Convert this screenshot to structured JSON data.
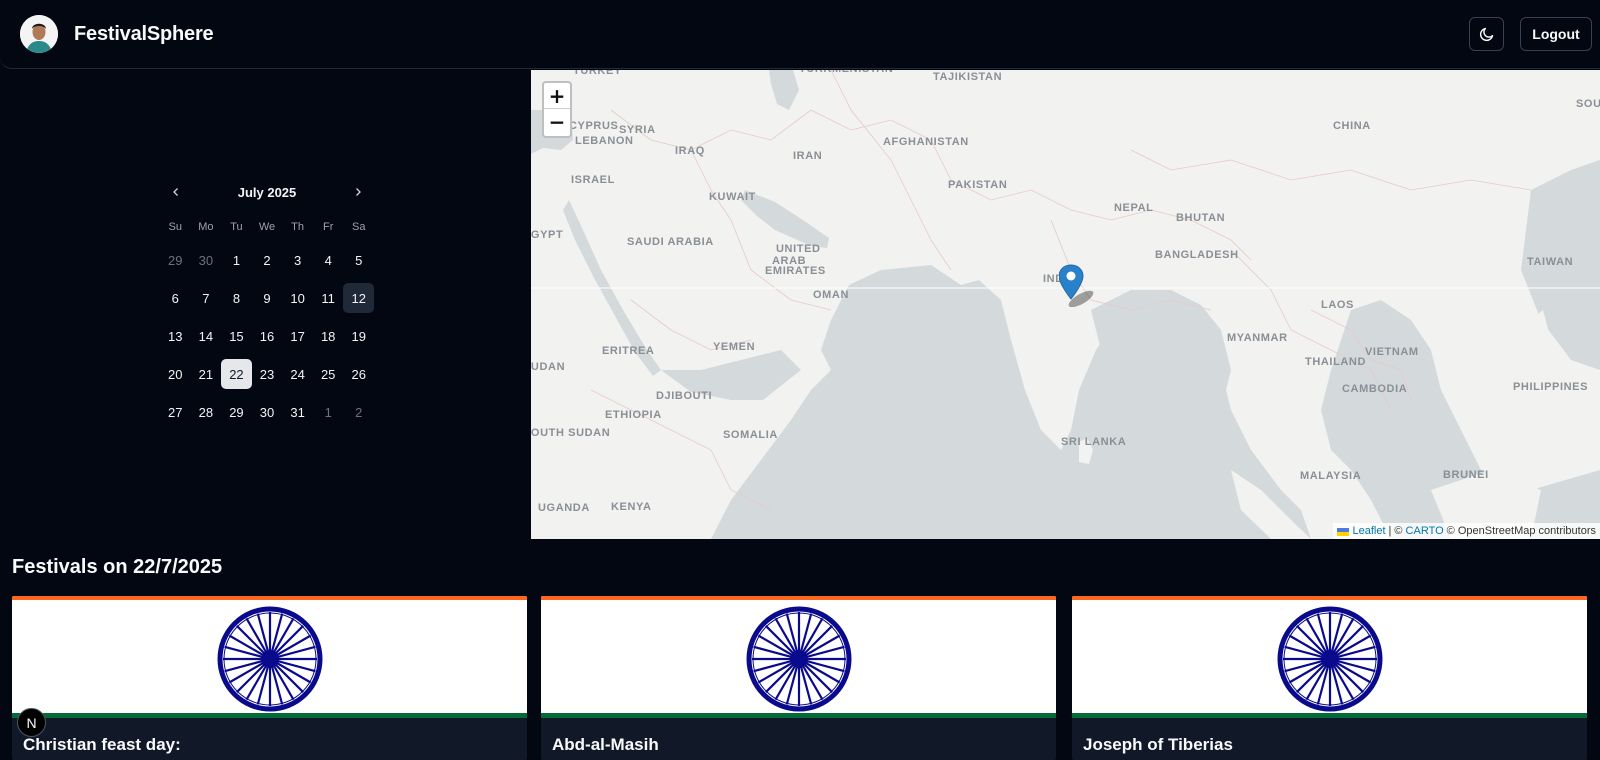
{
  "header": {
    "brand": "FestivalSphere",
    "logout_label": "Logout",
    "theme_icon": "moon-icon"
  },
  "calendar": {
    "month_label": "July 2025",
    "weekdays": [
      "Su",
      "Mo",
      "Tu",
      "We",
      "Th",
      "Fr",
      "Sa"
    ],
    "weeks": [
      [
        "29",
        "30",
        "1",
        "2",
        "3",
        "4",
        "5"
      ],
      [
        "6",
        "7",
        "8",
        "9",
        "10",
        "11",
        "12"
      ],
      [
        "13",
        "14",
        "15",
        "16",
        "17",
        "18",
        "19"
      ],
      [
        "20",
        "21",
        "22",
        "23",
        "24",
        "25",
        "26"
      ],
      [
        "27",
        "28",
        "29",
        "30",
        "31",
        "1",
        "2"
      ]
    ],
    "today": "12",
    "selected": "22"
  },
  "map": {
    "zoom_in": "+",
    "zoom_out": "−",
    "labels": [
      "TURKEY",
      "TURKMENISTAN",
      "TAJIKISTAN",
      "SYRIA",
      "LEBANON",
      "CYPRUS",
      "IRAQ",
      "IRAN",
      "AFGHANISTAN",
      "PAKISTAN",
      "CHINA",
      "SOUTH",
      "ISRAEL",
      "KUWAIT",
      "NEPAL",
      "BHUTAN",
      "EGYPT",
      "SAUDI ARABIA",
      "UNITED",
      "ARAB",
      "EMIRATES",
      "BANGLADESH",
      "TAIWAN",
      "INDIA",
      "OMAN",
      "LAOS",
      "MYANMAR",
      "SUDAN",
      "ERITREA",
      "YEMEN",
      "VIETNAM",
      "THAILAND",
      "PHILIPPINES",
      "DJIBOUTI",
      "CAMBODIA",
      "ETHIOPIA",
      "SOMALIA",
      "SOUTH SUDAN",
      "SRI LANKA",
      "MALAYSIA",
      "BRUNEI",
      "UGANDA",
      "KENYA"
    ],
    "attribution": {
      "leaflet": "Leaflet",
      "sep1": "| ©",
      "carto": "CARTO",
      "osm": "© OpenStreetMap contributors"
    },
    "marker_icon": "map-pin-icon",
    "water_color": "#d4dadc",
    "land_color": "#f2f2f0"
  },
  "festivals": {
    "title": "Festivals on 22/7/2025",
    "cards": [
      {
        "name": "Christian feast day:",
        "flag": "india-flag"
      },
      {
        "name": "Abd-al-Masih",
        "flag": "india-flag"
      },
      {
        "name": "Joseph of Tiberias",
        "flag": "india-flag"
      }
    ]
  },
  "badge": "N"
}
